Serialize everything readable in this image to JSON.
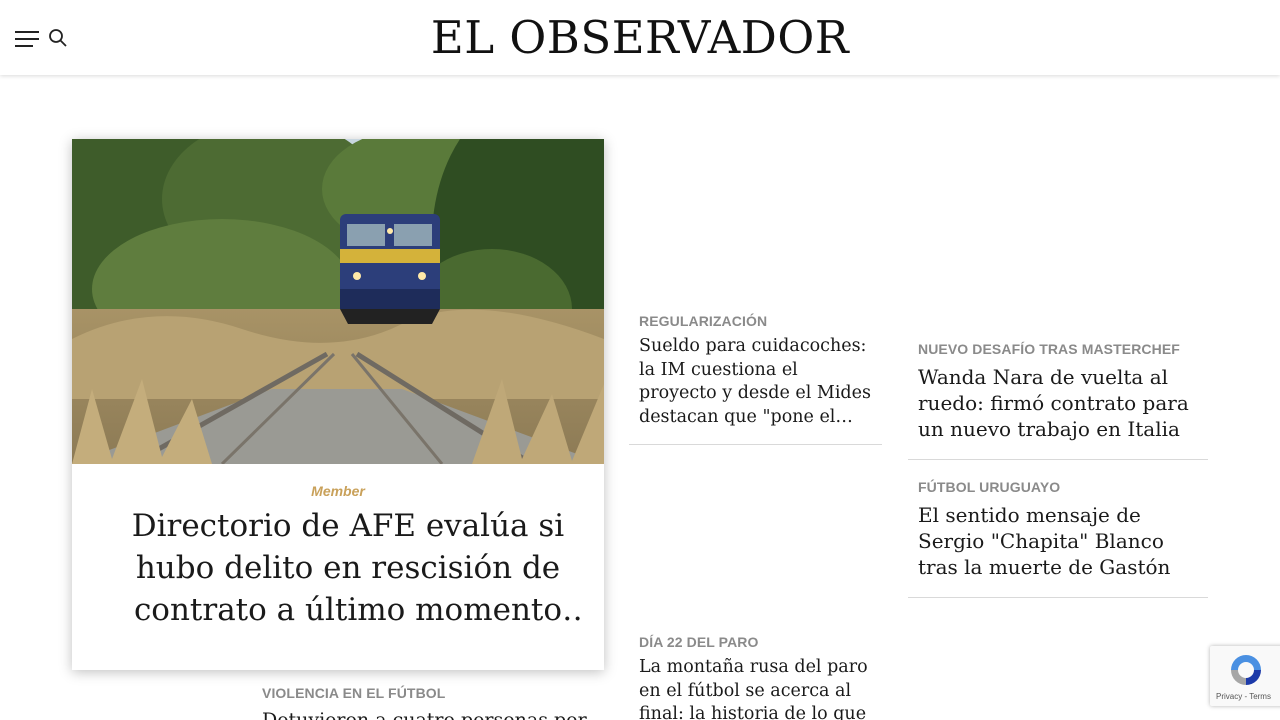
{
  "header": {
    "logo_text": "EL OBSERVADOR",
    "menu_icon": "hamburger-menu-icon",
    "search_icon": "search-icon"
  },
  "featured": {
    "image_alt": "train-on-tracks-photo",
    "tag": "Member",
    "title": "Directorio de AFE evalúa si hubo delito en rescisión de contrato a último momento a…"
  },
  "middle_column": [
    {
      "kicker": "REGULARIZACIÓN",
      "headline": "Sueldo para cuidacoches: la IM cuestiona el proyecto y desde el Mides destacan que \"pone el tema en…"
    },
    {
      "kicker": "DÍA 22 DEL PARO",
      "headline": "La montaña rusa del paro en el fútbol se acerca al final: la historia de lo que"
    }
  ],
  "right_column": [
    {
      "kicker": "NUEVO DESAFÍO TRAS MASTERCHEF",
      "headline": "Wanda Nara de vuelta al ruedo: firmó contrato para un nuevo trabajo en Italia"
    },
    {
      "kicker": "FÚTBOL URUGUAYO",
      "headline": "El sentido mensaje de Sergio \"Chapita\" Blanco tras la muerte de Gastón Machado"
    }
  ],
  "bottom_left": {
    "kicker": "VIOLENCIA EN EL FÚTBOL",
    "headline": "Detuvieron a cuatro personas por"
  },
  "recaptcha": {
    "links": "Privacy - Terms",
    "icon": "recaptcha-logo-icon"
  },
  "colors": {
    "member_tag": "#c9a15a",
    "kicker": "#8a8a8a",
    "headline": "#1a1a1a"
  }
}
